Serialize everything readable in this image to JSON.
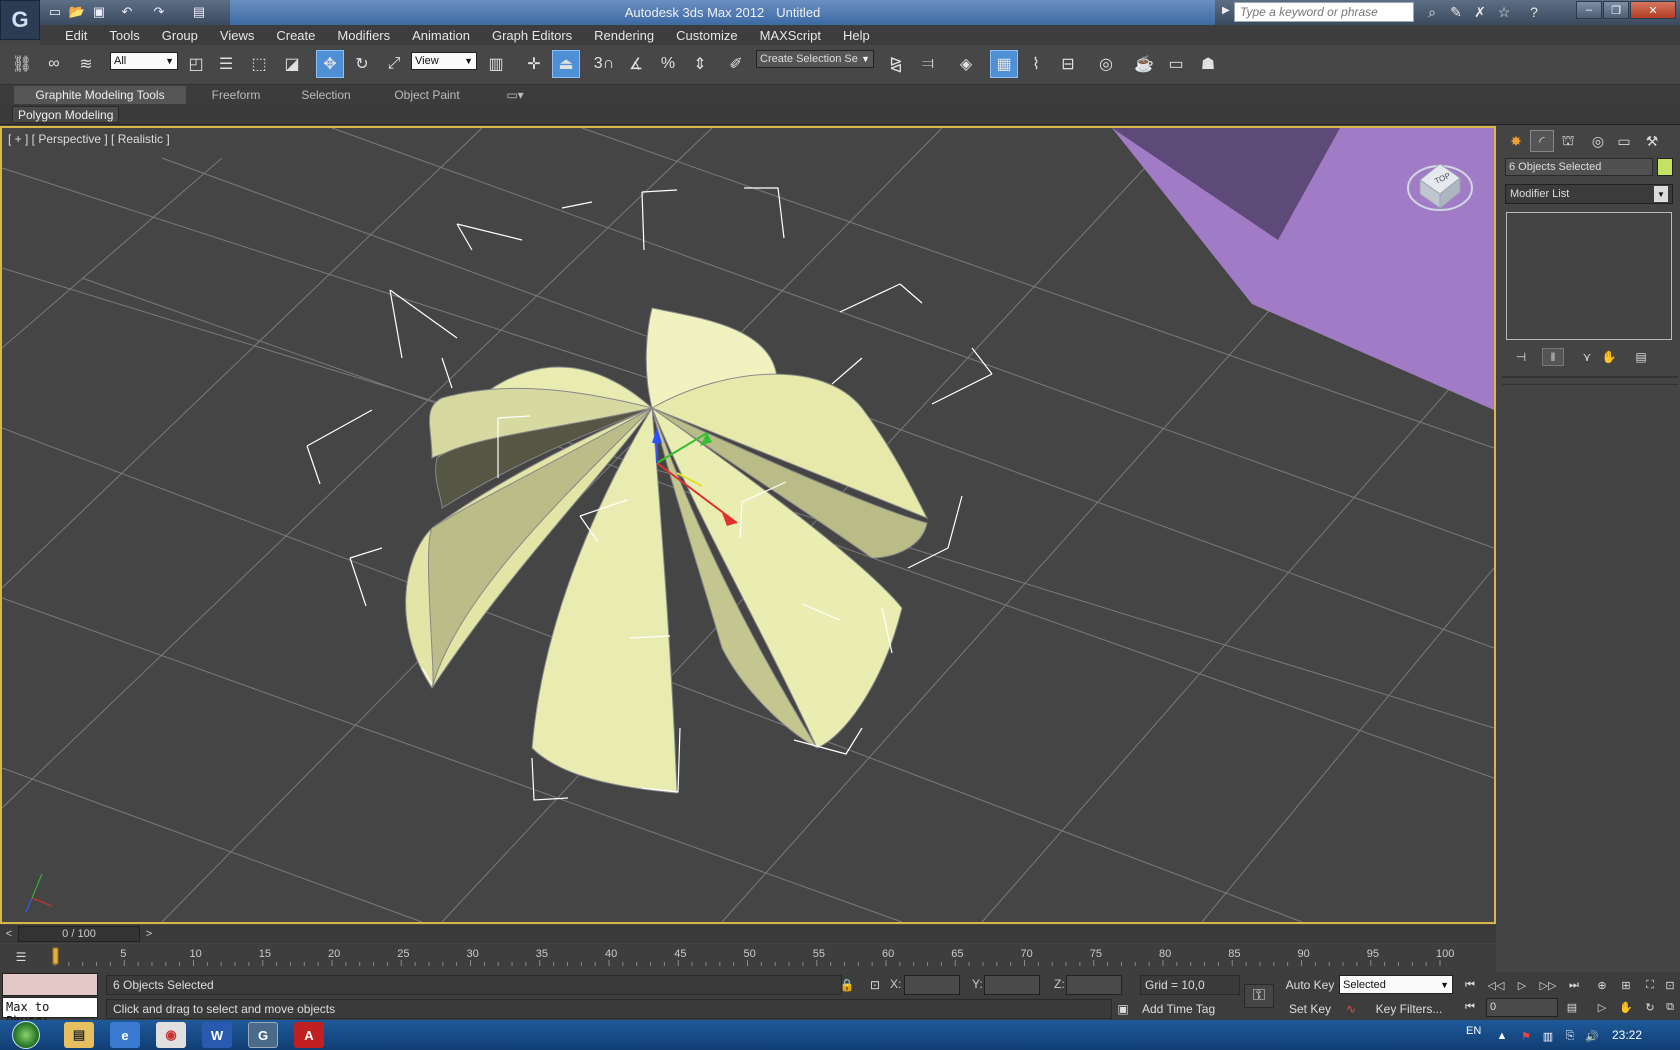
{
  "window": {
    "app_name": "Autodesk 3ds Max  2012",
    "doc_name": "Untitled",
    "search_placeholder": "Type a keyword or phrase"
  },
  "menu": [
    "Edit",
    "Tools",
    "Group",
    "Views",
    "Create",
    "Modifiers",
    "Animation",
    "Graph Editors",
    "Rendering",
    "Customize",
    "MAXScript",
    "Help"
  ],
  "toolbar": {
    "filter_value": "All",
    "ref_coord_value": "View",
    "selection_set_value": "Create Selection Se",
    "snap_label": "3"
  },
  "ribbon": {
    "tabs": [
      "Graphite Modeling Tools",
      "Freeform",
      "Selection",
      "Object Paint"
    ],
    "sub_label": "Polygon Modeling"
  },
  "viewport": {
    "label": "[ + ] [ Perspective ] [ Realistic ]",
    "viewcube_face": "TOP",
    "petal_color": "#e4e8a8",
    "plane_color": "#a27bc6"
  },
  "command_panel": {
    "object_name": "6 Objects Selected",
    "object_color": "#c6e061",
    "modifier_list": "Modifier List"
  },
  "timeline": {
    "frame_display": "0 / 100",
    "prev": "<",
    "next": ">",
    "ticks": [
      "5",
      "10",
      "15",
      "20",
      "25",
      "30",
      "35",
      "40",
      "45",
      "50",
      "55",
      "60",
      "65",
      "70",
      "75",
      "80",
      "85",
      "90",
      "95",
      "100"
    ]
  },
  "status": {
    "maxscript_text": "Max to Physc:",
    "selection_text": "6 Objects Selected",
    "prompt_text": "Click and drag to select and move objects",
    "x_label": "X:",
    "y_label": "Y:",
    "z_label": "Z:",
    "grid_text": "Grid = 10,0",
    "add_time_tag": "Add Time Tag",
    "auto_key": "Auto Key",
    "selected_value": "Selected",
    "set_key": "Set Key",
    "key_filters": "Key Filters...",
    "frame_value": "0"
  },
  "taskbar": {
    "language": "EN",
    "clock": "23:22"
  }
}
